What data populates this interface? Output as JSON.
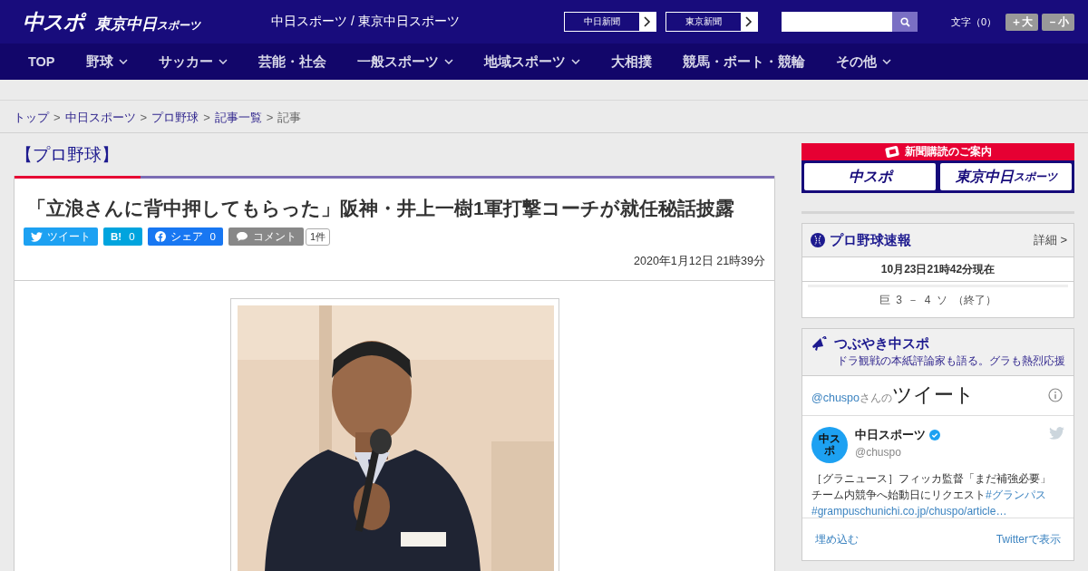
{
  "header": {
    "logo_main": "中スポ",
    "logo_sub": "東京中日",
    "logo_sub_small": "スポーツ",
    "site_title": "中日スポーツ / 東京中日スポーツ",
    "link_buttons": [
      "中日新聞",
      "東京新聞"
    ],
    "font_size": {
      "label": "文字（0）",
      "buttons": [
        "＋大",
        "－小"
      ]
    }
  },
  "nav": [
    {
      "label": "TOP",
      "dropdown": false
    },
    {
      "label": "野球",
      "dropdown": true
    },
    {
      "label": "サッカー",
      "dropdown": true
    },
    {
      "label": "芸能・社会",
      "dropdown": false
    },
    {
      "label": "一般スポーツ",
      "dropdown": true
    },
    {
      "label": "地域スポーツ",
      "dropdown": true
    },
    {
      "label": "大相撲",
      "dropdown": false
    },
    {
      "label": "競馬・ボート・競輪",
      "dropdown": false
    },
    {
      "label": "その他",
      "dropdown": true
    }
  ],
  "breadcrumbs": [
    {
      "label": "トップ",
      "link": true
    },
    {
      "separator": ">",
      "label": "中日スポーツ",
      "link": true
    },
    {
      "separator": ">",
      "label": "プロ野球",
      "link": true
    },
    {
      "separator": ">",
      "label": "記事一覧",
      "link": true
    },
    {
      "separator": ">",
      "label": "記事",
      "link": false
    }
  ],
  "category": "【プロ野球】",
  "article": {
    "headline": "「立浪さんに背中押してもらった」阪神・井上一樹1軍打撃コーチが就任秘話披露",
    "share": [
      {
        "kind": "twitter",
        "label": "ツイート"
      },
      {
        "kind": "hatena",
        "label": "B!",
        "count": "0"
      },
      {
        "kind": "facebook",
        "label": "シェア",
        "count": "0"
      },
      {
        "kind": "comment",
        "label": "コメント"
      }
    ],
    "comment_count": "1件",
    "date": "2020年1月12日 21時39分"
  },
  "sidebar": {
    "subscribe": {
      "title": "新聞購読のご案内",
      "papers": [
        {
          "main": "中スポ"
        },
        {
          "main": "東京中日",
          "small": "スポーツ"
        }
      ]
    },
    "scores": {
      "title": "プロ野球速報",
      "more": "詳細 >",
      "updated": "10月23日21時42分現在",
      "games": [
        "巨 3 － 4 ソ （終了）"
      ]
    },
    "tweets": {
      "title": "つぶやき中スポ",
      "subtitle": "ドラ観戦の本紙評論家も語る。グラも熱烈応援",
      "timeline": {
        "handle": "@chuspo",
        "suffix": "さんの",
        "heading": "ツイート"
      },
      "tweet": {
        "name": "中日スポーツ",
        "verified": true,
        "handle": "@chuspo",
        "avatar_text": "中スポ",
        "body": [
          {
            "kind": "text",
            "text": "［グラニュース］フィッカ監督「まだ補強必要」チーム内競争へ始動日にリクエスト"
          },
          {
            "kind": "link",
            "text": "#グランパス"
          },
          {
            "kind": "link",
            "text": "#grampuschunichi.co.jp/chuspo/article…"
          }
        ]
      },
      "footer": [
        "埋め込む",
        "Twitterで表示"
      ]
    }
  }
}
